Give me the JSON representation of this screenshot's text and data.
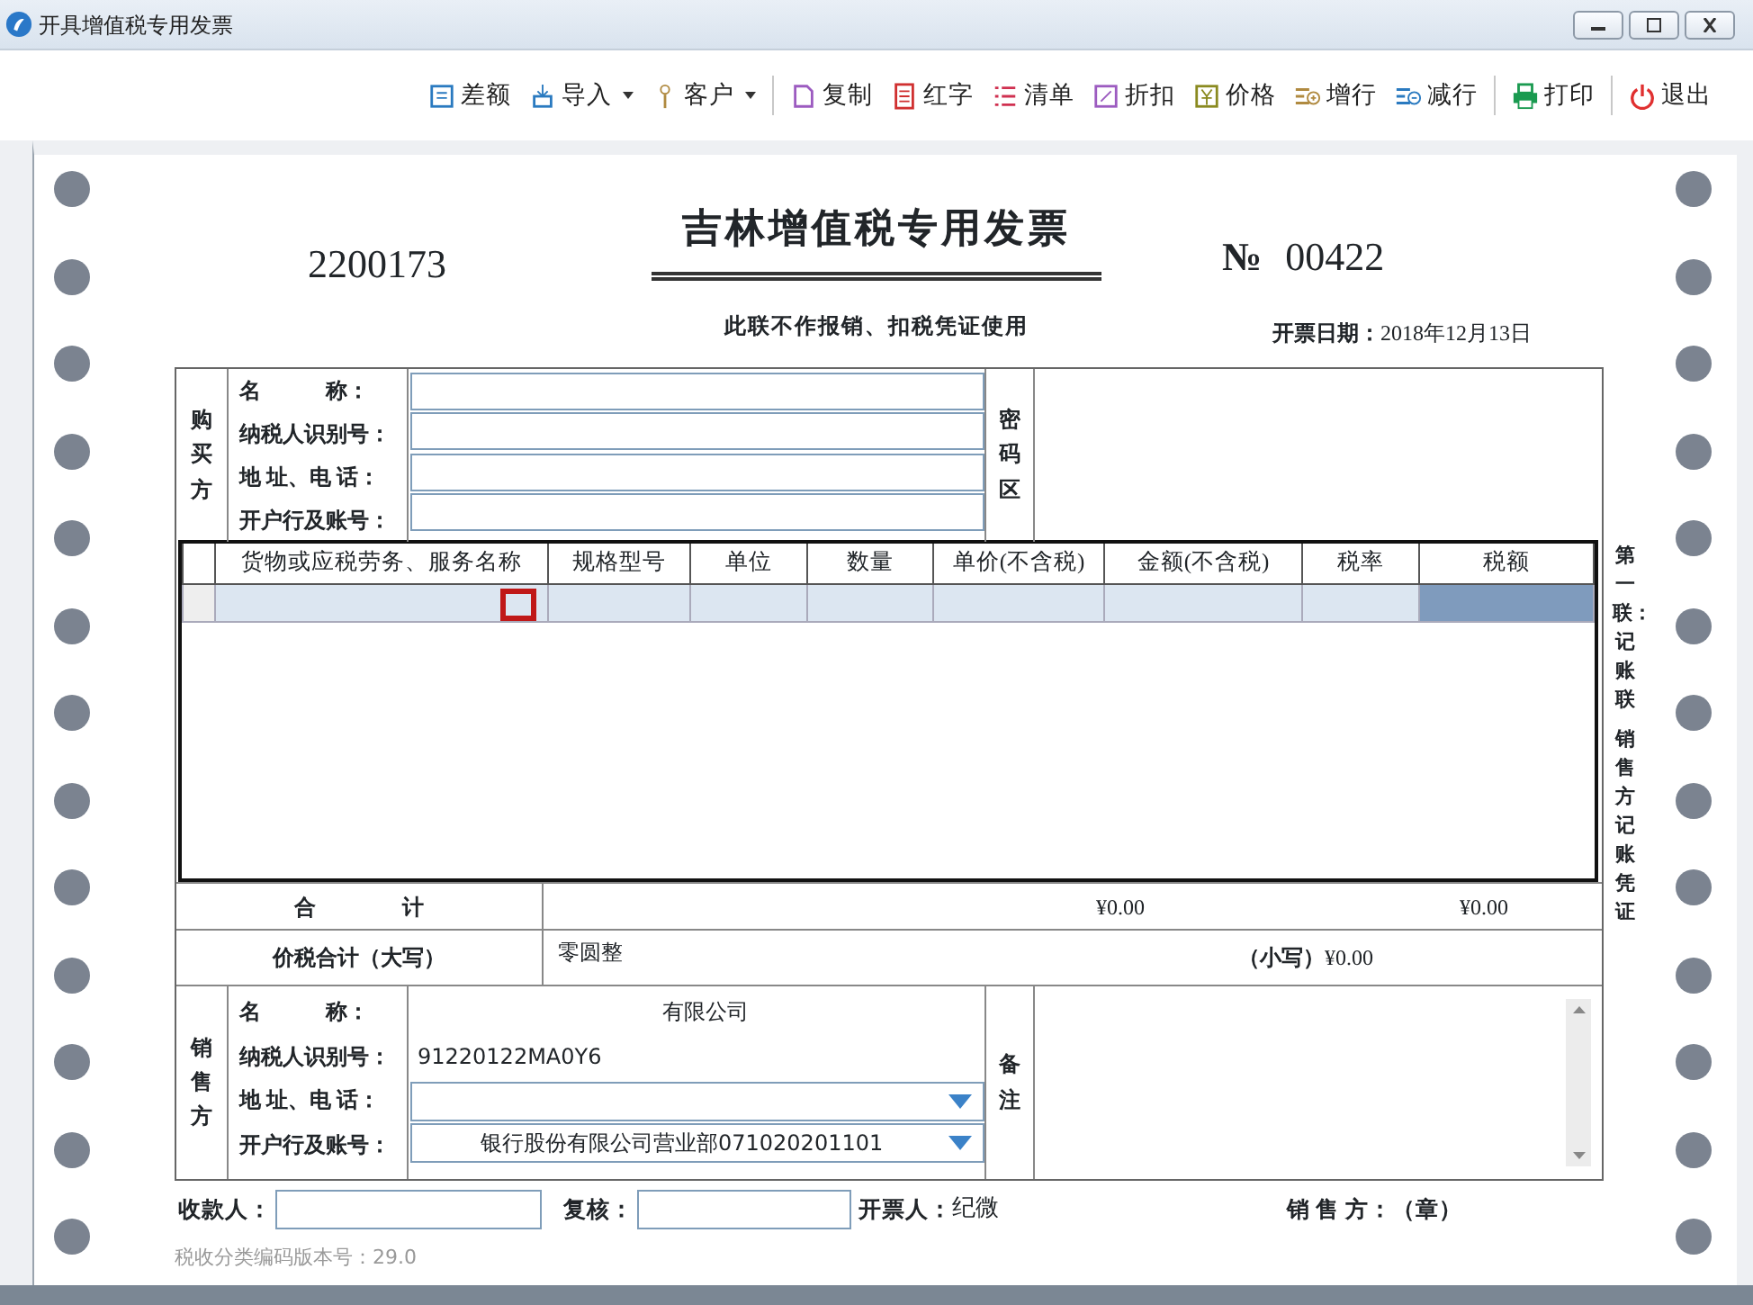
{
  "window": {
    "title": "开具增值税专用发票"
  },
  "toolbar": [
    {
      "kind": "button",
      "label": "差额",
      "dropdown": false
    },
    {
      "kind": "button",
      "label": "导入",
      "dropdown": true
    },
    {
      "kind": "button",
      "label": "客户",
      "dropdown": true
    },
    {
      "kind": "separator"
    },
    {
      "kind": "button",
      "label": "复制",
      "dropdown": false
    },
    {
      "kind": "button",
      "label": "红字",
      "dropdown": false
    },
    {
      "kind": "button",
      "label": "清单",
      "dropdown": false
    },
    {
      "kind": "button",
      "label": "折扣",
      "dropdown": false
    },
    {
      "kind": "button",
      "label": "价格",
      "dropdown": false
    },
    {
      "kind": "button",
      "label": "增行",
      "dropdown": false
    },
    {
      "kind": "button",
      "label": "减行",
      "dropdown": false
    },
    {
      "kind": "separator"
    },
    {
      "kind": "button",
      "label": "打印",
      "dropdown": false
    },
    {
      "kind": "separator"
    },
    {
      "kind": "button",
      "label": "退出",
      "dropdown": false
    }
  ],
  "invoice": {
    "code": "2200173",
    "title": "吉林增值税专用发票",
    "number_mark": "№",
    "number": "00422",
    "notice": "此联不作报销、扣税凭证使用",
    "date_label": "开票日期：",
    "date": "2018年12月13日"
  },
  "buyer": {
    "side_label": "购买方",
    "fields": [
      {
        "label": "名　　　称："
      },
      {
        "label": "纳税人识别号："
      },
      {
        "label": "地 址、电 话："
      },
      {
        "label": "开户行及账号："
      }
    ],
    "cipher_label": "密码区"
  },
  "items": {
    "columns": [
      "货物或应税劳务、服务名称",
      "规格型号",
      "单位",
      "数量",
      "单价(不含税)",
      "金额(不含税)",
      "税率",
      "税额"
    ],
    "rows": [
      {
        "selected": true
      }
    ]
  },
  "copy_label": [
    "第一联：记账联",
    "销售方记账凭证"
  ],
  "totals": {
    "label": "合　　　　计",
    "amount": "¥0.00",
    "tax": "¥0.00"
  },
  "grand_total": {
    "label": "价税合计（大写）",
    "upper": "零圆整",
    "lower_label": "（小写）",
    "lower": "¥0.00"
  },
  "seller": {
    "side_label": "销售方",
    "fields": [
      {
        "label": "名　　　称：",
        "value": "有限公司",
        "kind": "text"
      },
      {
        "label": "纳税人识别号：",
        "value": "91220122MA0Y6",
        "kind": "text"
      },
      {
        "label": "地 址、电 话：",
        "kind": "combo"
      },
      {
        "label": "开户行及账号：",
        "value": "银行股份有限公司营业部071020201101",
        "kind": "combo"
      }
    ],
    "remarks_label": "备注"
  },
  "footer": {
    "payee_label": "收款人：",
    "reviewer_label": "复核：",
    "drawer_label": "开票人：",
    "drawer": "纪微",
    "seal": "销 售 方：（章）",
    "version": "税收分类编码版本号：29.0"
  }
}
